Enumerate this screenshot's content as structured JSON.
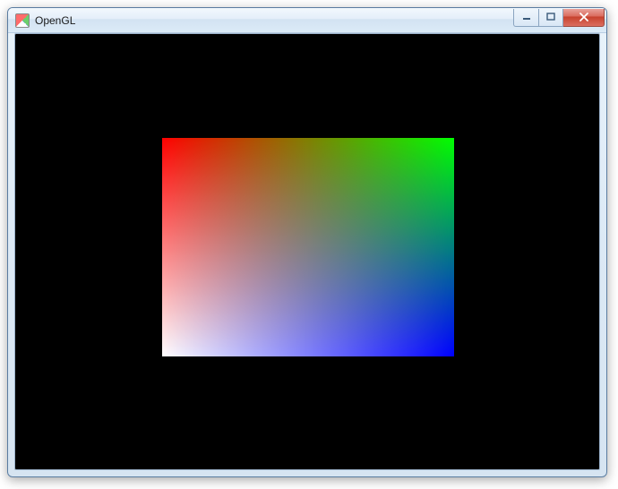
{
  "window": {
    "title": "OpenGL",
    "icon_name": "opengl-app-icon"
  },
  "controls": {
    "minimize": "Minimize",
    "maximize": "Maximize",
    "close": "Close"
  },
  "render": {
    "clear_color": "#000000",
    "quad": {
      "vertices": [
        {
          "corner": "top-left",
          "color": "#ff0000"
        },
        {
          "corner": "top-right",
          "color": "#00ff00"
        },
        {
          "corner": "bottom-right",
          "color": "#0000ff"
        },
        {
          "corner": "bottom-left",
          "color": "#ffffff"
        }
      ]
    }
  }
}
